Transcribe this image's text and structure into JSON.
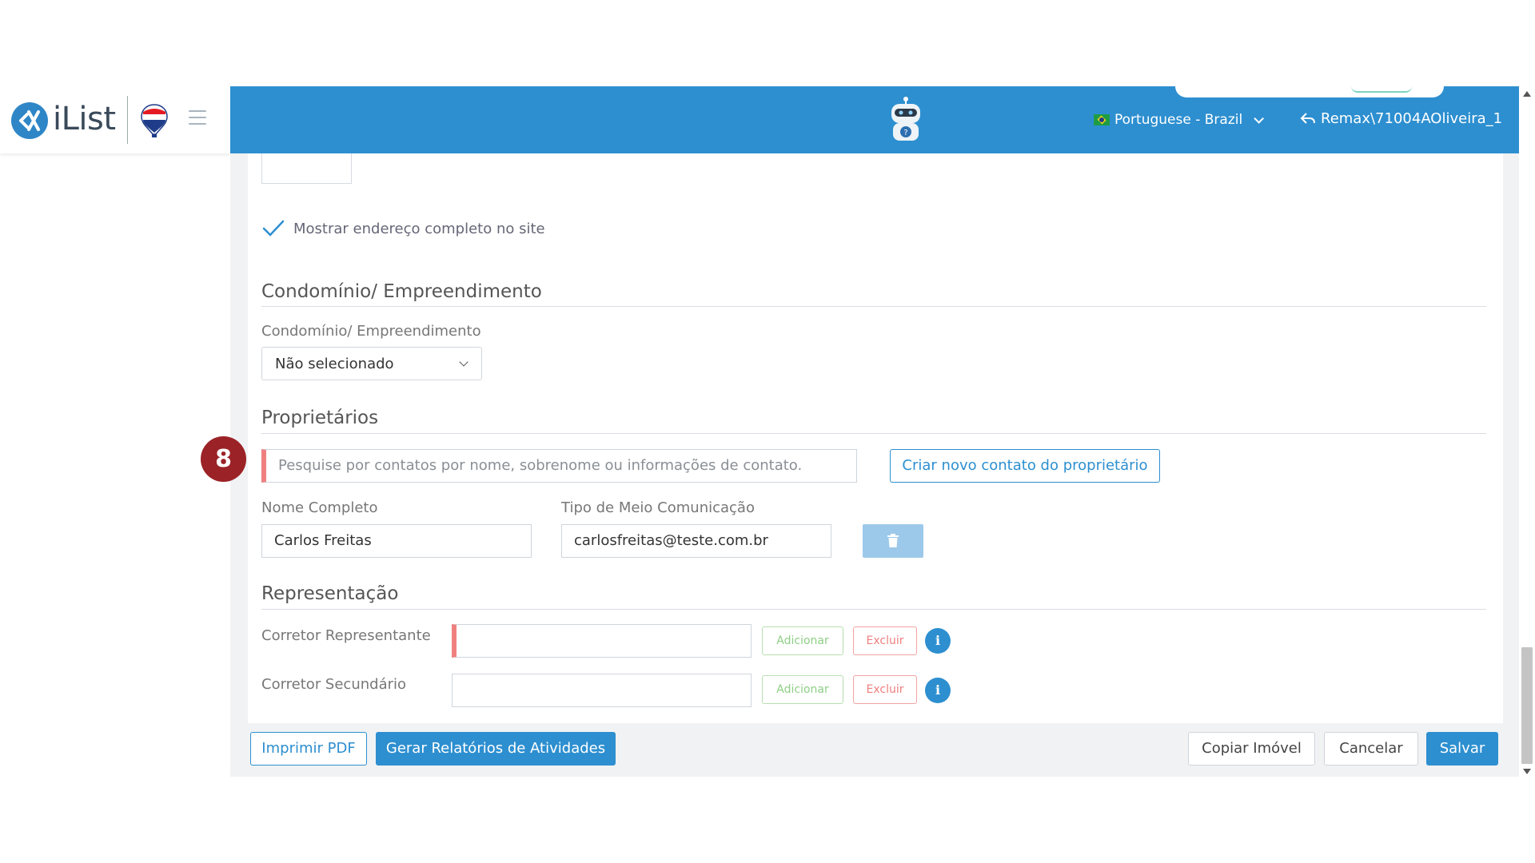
{
  "brand": {
    "logo_text": "iList"
  },
  "header": {
    "language": "Portuguese - Brazil",
    "user": "Remax\\71004AOliveira_1"
  },
  "form": {
    "show_address_label": "Mostrar endereço completo no site",
    "condo_section_title": "Condomínio/ Empreendimento",
    "condo_field_label": "Condomínio/ Empreendimento",
    "condo_select_value": "Não selecionado",
    "owners_section_title": "Proprietários",
    "owner_search_placeholder": "Pesquise por contatos por nome, sobrenome ou informações de contato.",
    "create_owner_label": "Criar novo contato do proprietário",
    "full_name_label": "Nome Completo",
    "full_name_value": "Carlos Freitas",
    "comm_type_label": "Tipo de Meio Comunicação",
    "comm_value": "carlosfreitas@teste.com.br",
    "representation_title": "Representação",
    "agent_rep_label": "Corretor Representante",
    "agent_sec_label": "Corretor Secundário",
    "add_label": "Adicionar",
    "delete_label": "Excluir",
    "info_glyph": "i"
  },
  "footer": {
    "print_pdf": "Imprimir PDF",
    "reports": "Gerar Relatórios de Atividades",
    "copy": "Copiar Imóvel",
    "cancel": "Cancelar",
    "save": "Salvar"
  },
  "step_badge": "8",
  "colors": {
    "primary": "#2d8fd0",
    "badge": "#9b2226",
    "required": "#f08080"
  }
}
